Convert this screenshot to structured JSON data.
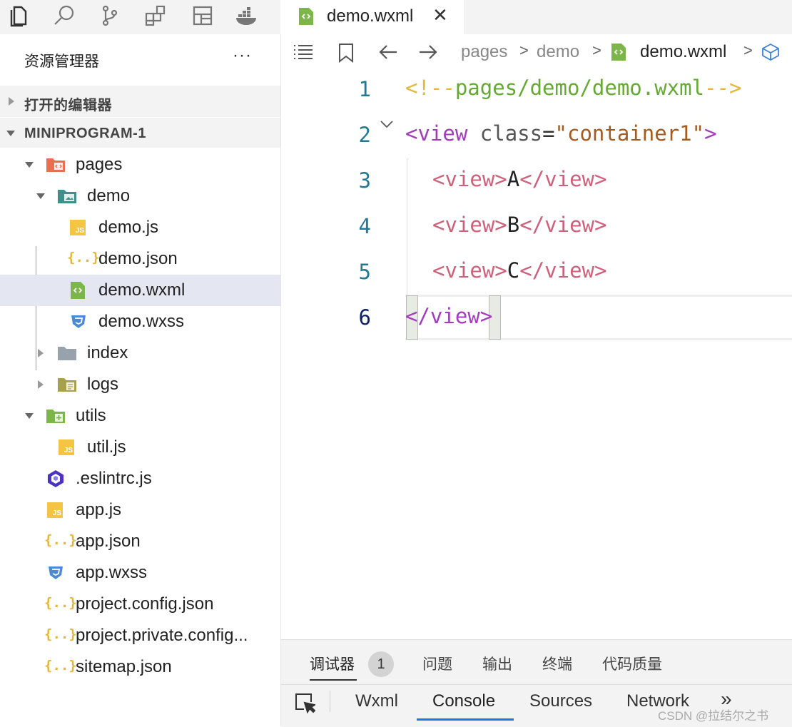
{
  "activity_bar": {
    "icons": [
      "files-icon",
      "search-icon",
      "source-control-icon",
      "extensions-icon",
      "layout-icon",
      "docker-icon"
    ]
  },
  "sidebar": {
    "title": "资源管理器",
    "more": "···",
    "sections": {
      "open_editors": "打开的编辑器",
      "project": "MINIPROGRAM-1"
    },
    "tree": [
      {
        "name": "pages",
        "kind": "folder-pages",
        "expanded": true
      },
      {
        "name": "demo",
        "kind": "folder-demo",
        "expanded": true
      },
      {
        "name": "demo.js",
        "kind": "js"
      },
      {
        "name": "demo.json",
        "kind": "json"
      },
      {
        "name": "demo.wxml",
        "kind": "wxml",
        "selected": true
      },
      {
        "name": "demo.wxss",
        "kind": "css"
      },
      {
        "name": "index",
        "kind": "folder",
        "expanded": false
      },
      {
        "name": "logs",
        "kind": "folder-logs",
        "expanded": false
      },
      {
        "name": "utils",
        "kind": "folder-utils",
        "expanded": true
      },
      {
        "name": "util.js",
        "kind": "js"
      },
      {
        "name": ".eslintrc.js",
        "kind": "eslint"
      },
      {
        "name": "app.js",
        "kind": "js"
      },
      {
        "name": "app.json",
        "kind": "json"
      },
      {
        "name": "app.wxss",
        "kind": "css"
      },
      {
        "name": "project.config.json",
        "kind": "json"
      },
      {
        "name": "project.private.config...",
        "kind": "json"
      },
      {
        "name": "sitemap.json",
        "kind": "json"
      }
    ]
  },
  "editor": {
    "tab": {
      "name": "demo.wxml",
      "close": "✕"
    },
    "breadcrumb": [
      "pages",
      "demo",
      "demo.wxml"
    ],
    "breadcrumb_sep": ">",
    "lines": [
      {
        "number": "1"
      },
      {
        "number": "2"
      },
      {
        "number": "3"
      },
      {
        "number": "4"
      },
      {
        "number": "5"
      },
      {
        "number": "6"
      }
    ],
    "code": {
      "l1_open": "<!--",
      "l1_text": "pages/demo/demo.wxml",
      "l1_close": "-->",
      "l2_tag": "<view",
      "l2_attr": " class",
      "l2_eq": "=",
      "l2_str": "\"container1\"",
      "l2_end": ">",
      "open_tag": "<view>",
      "close_tag": "</view>",
      "l3_text": "A",
      "l4_text": "B",
      "l5_text": "C",
      "l6_lt": "<",
      "l6_tag": "/view",
      "l6_gt": ">"
    }
  },
  "panel": {
    "tabs": [
      "调试器",
      "问题",
      "输出",
      "终端",
      "代码质量"
    ],
    "badge": "1",
    "devtools_tabs": [
      "Wxml",
      "Console",
      "Sources",
      "Network"
    ],
    "more": "»",
    "active_devtools_tab": "Console"
  },
  "watermark": "CSDN @拉结尔之书"
}
